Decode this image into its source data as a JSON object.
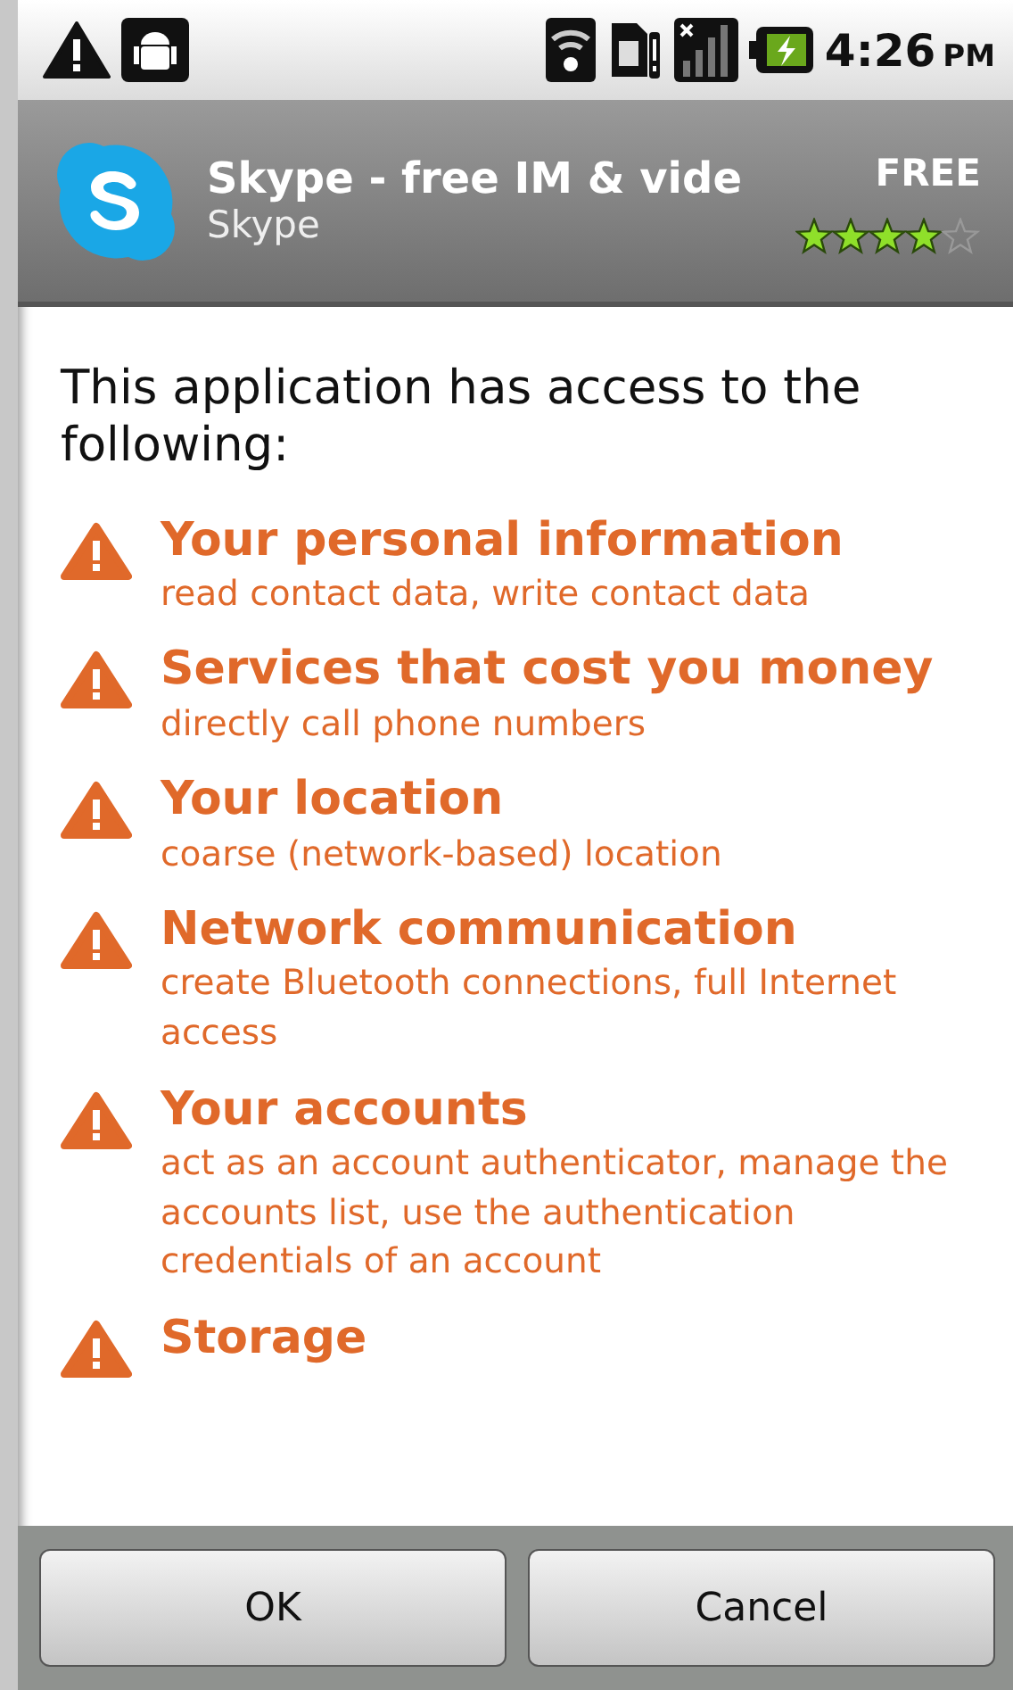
{
  "status_bar": {
    "time": "4:26",
    "ampm": "PM"
  },
  "app": {
    "title": "Skype - free IM & vide",
    "developer": "Skype",
    "price": "FREE",
    "stars": 4
  },
  "intro": "This application has access to the following:",
  "permissions": [
    {
      "title": "Your personal information",
      "description": "read contact data, write contact data"
    },
    {
      "title": "Services that cost you money",
      "description": "directly call phone numbers"
    },
    {
      "title": "Your location",
      "description": "coarse (network-based) location"
    },
    {
      "title": "Network communication",
      "description": "create Bluetooth connections, full Internet access"
    },
    {
      "title": "Your accounts",
      "description": "act as an account authenticator, manage the accounts list, use the authentication credentials of an account"
    },
    {
      "title": "Storage"
    }
  ],
  "buttons": [
    "OK",
    "Cancel"
  ]
}
